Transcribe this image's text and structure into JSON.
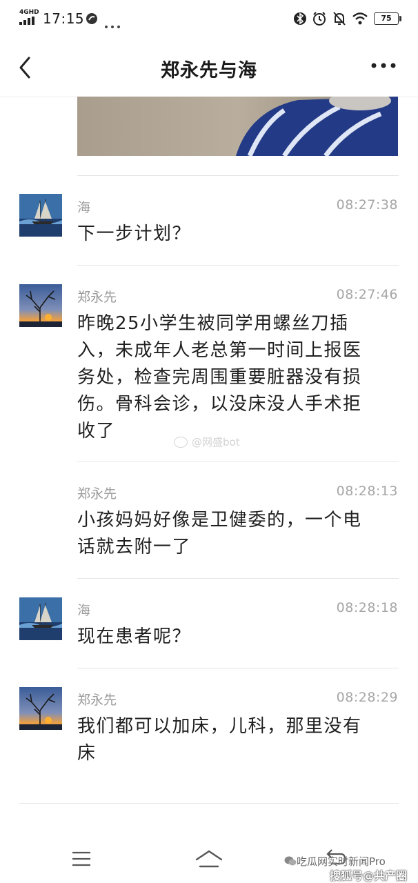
{
  "status_bar": {
    "network": "4GHD",
    "time": "17:15",
    "battery": "75"
  },
  "header": {
    "title": "郑永先与海"
  },
  "messages": [
    {
      "sender": "海",
      "time": "08:27:38",
      "text": "下一步计划？",
      "avatar": "ship-avatar"
    },
    {
      "sender": "郑永先",
      "time": "08:27:46",
      "lines": [
        "昨晚25小学生被同学用螺丝刀插",
        "入，未成年人老总第一时间上报医",
        "务处，检查完周围重要脏器没有损",
        "伤。骨科会诊，以没床没人手术拒",
        "收了"
      ],
      "avatar": "tree-sunset-avatar"
    },
    {
      "sender": "郑永先",
      "time": "08:28:13",
      "lines": [
        "小孩妈妈好像是卫健委的，一个电",
        "话就去附一了"
      ]
    },
    {
      "sender": "海",
      "time": "08:28:18",
      "text": "现在患者呢？",
      "avatar": "ship-avatar"
    },
    {
      "sender": "郑永先",
      "time": "08:28:29",
      "lines": [
        "我们都可以加床，儿科，那里没有",
        "床"
      ],
      "avatar": "tree-sunset-avatar"
    }
  ],
  "watermark": "@网盛bot",
  "credit": {
    "line1": "吃瓜网实时新闻Pro",
    "line2": "搜狐号@共产圈"
  }
}
